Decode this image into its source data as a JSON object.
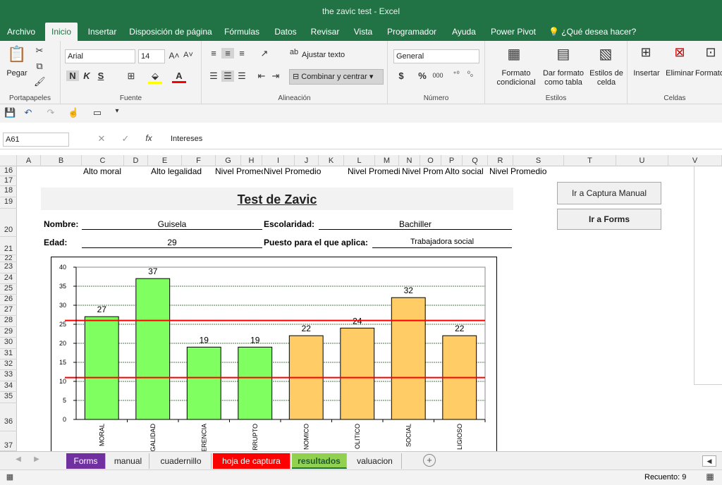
{
  "window": {
    "title": "the zavic test  -  Excel"
  },
  "ribbon_tabs": [
    "Archivo",
    "Inicio",
    "Insertar",
    "Disposición de página",
    "Fórmulas",
    "Datos",
    "Revisar",
    "Vista",
    "Programador",
    "Ayuda",
    "Power Pivot",
    "¿Qué desea hacer?"
  ],
  "ribbon": {
    "paste": "Pegar",
    "font_name": "Arial",
    "font_size": "14",
    "wrap_text": "Ajustar texto",
    "merge_center": "Combinar y centrar",
    "number_format": "General",
    "cond_format": [
      "Formato",
      "condicional"
    ],
    "format_table": [
      "Dar formato",
      "como tabla"
    ],
    "cell_styles": [
      "Estilos de",
      "celda"
    ],
    "insert": "Insertar",
    "delete": "Eliminar",
    "format": "Formato",
    "bold": "N",
    "italic": "K",
    "underline": "S",
    "currency": "$",
    "percent": "%",
    "thousands": "000",
    "groups": [
      "Portapapeles",
      "Fuente",
      "Alineación",
      "Número",
      "Estilos",
      "Celdas"
    ]
  },
  "formula_bar": {
    "name_box": "A61",
    "fx": "fx",
    "content": "Intereses"
  },
  "columns": [
    "A",
    "B",
    "C",
    "D",
    "E",
    "F",
    "G",
    "H",
    "I",
    "J",
    "K",
    "L",
    "M",
    "N",
    "O",
    "P",
    "Q",
    "R",
    "S",
    "T",
    "U",
    "V"
  ],
  "rows": [
    "16",
    "17",
    "18",
    "19",
    "20",
    "21",
    "22",
    "23",
    "24",
    "25",
    "26",
    "27",
    "28",
    "29",
    "30",
    "31",
    "32",
    "33",
    "34",
    "35",
    "36",
    "37"
  ],
  "row16": [
    "Alto moral",
    "Alto legalidad",
    "Nivel Promedio",
    "Nivel Promedio",
    "Nivel Promedi",
    "Nivel Prom",
    "Alto social",
    "Nivel Promedio"
  ],
  "sheet": {
    "title": "Test de Zavic",
    "name_label": "Nombre:",
    "name_value": "Guisela",
    "school_label": "Escolaridad:",
    "school_value": "Bachiller",
    "age_label": "Edad:",
    "age_value": "29",
    "job_label": "Puesto para el que aplica:",
    "job_value": "Trabajadora social"
  },
  "buttons": {
    "manual": "Ir a Captura Manual",
    "forms": "Ir a Forms"
  },
  "chart_data": {
    "type": "bar",
    "categories": [
      "MORAL",
      "LEGALIDAD",
      "INDIFERENCIA",
      "CORRUPTO",
      "ECONOMICO",
      "POLITICO",
      "SOCIAL",
      "RELIGIOSO"
    ],
    "category_labels_visible": [
      "MORAL",
      "EGALIDAD",
      "FERENCIA",
      "RRUPTO",
      "NOMICO",
      "OLITICO",
      "SOCIAL",
      "LIGIOSO"
    ],
    "values": [
      27,
      37,
      19,
      19,
      22,
      24,
      32,
      22
    ],
    "bar_colors": [
      "#80ff60",
      "#80ff60",
      "#80ff60",
      "#80ff60",
      "#ffcc66",
      "#ffcc66",
      "#ffcc66",
      "#ffcc66"
    ],
    "ylim": [
      0,
      40
    ],
    "yticks": [
      0,
      5,
      10,
      15,
      20,
      25,
      30,
      35,
      40
    ],
    "reference_lines": [
      26,
      11
    ],
    "reference_color": "#ff0000",
    "grid": true
  },
  "sheet_tabs": [
    {
      "label": "Forms",
      "bg": "#7030a0",
      "fg": "#ffffff"
    },
    {
      "label": "manual",
      "bg": "#f0f0f0",
      "fg": "#222222"
    },
    {
      "label": "cuadernillo",
      "bg": "#f0f0f0",
      "fg": "#222222"
    },
    {
      "label": "hoja de captura",
      "bg": "#ff0000",
      "fg": "#ffffff"
    },
    {
      "label": "resultados",
      "bg": "#92d050",
      "fg": "#1e5c2e"
    },
    {
      "label": "valuacion",
      "bg": "#f0f0f0",
      "fg": "#222222"
    }
  ],
  "status": {
    "count": "Recuento: 9"
  }
}
